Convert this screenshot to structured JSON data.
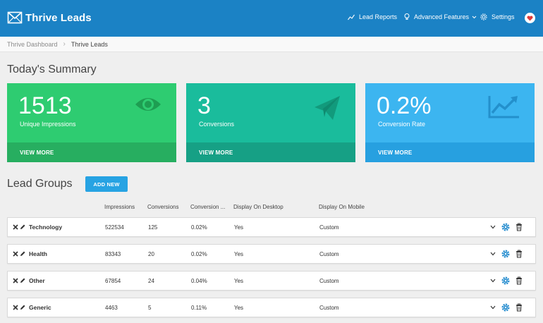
{
  "app": {
    "name": "Thrive Leads"
  },
  "nav": {
    "lead_reports": "Lead Reports",
    "advanced_features": "Advanced Features",
    "settings": "Settings"
  },
  "breadcrumb": {
    "root": "Thrive Dashboard",
    "current": "Thrive Leads"
  },
  "summary": {
    "title": "Today's Summary",
    "cards": [
      {
        "value": "1513",
        "label": "Unique Impressions",
        "action": "VIEW MORE",
        "icon": "eye-icon",
        "color": "#2ecc71"
      },
      {
        "value": "3",
        "label": "Conversions",
        "action": "VIEW MORE",
        "icon": "paper-plane-icon",
        "color": "#1abc9c"
      },
      {
        "value": "0.2%",
        "label": "Conversion Rate",
        "action": "VIEW MORE",
        "icon": "chart-trend-icon",
        "color": "#3cb5f0"
      }
    ]
  },
  "lead_groups": {
    "title": "Lead Groups",
    "add_new": "ADD NEW",
    "columns": [
      "Impressions",
      "Conversions",
      "Conversion ...",
      "Display On Desktop",
      "Display On Mobile"
    ],
    "rows": [
      {
        "name": "Technology",
        "impressions": "522534",
        "conversions": "125",
        "rate": "0.02%",
        "desktop": "Yes",
        "mobile": "Custom"
      },
      {
        "name": "Health",
        "impressions": "83343",
        "conversions": "20",
        "rate": "0.02%",
        "desktop": "Yes",
        "mobile": "Custom"
      },
      {
        "name": "Other",
        "impressions": "67854",
        "conversions": "24",
        "rate": "0.04%",
        "desktop": "Yes",
        "mobile": "Custom"
      },
      {
        "name": "Generic",
        "impressions": "4463",
        "conversions": "5",
        "rate": "0.11%",
        "desktop": "Yes",
        "mobile": "Custom"
      }
    ]
  },
  "colors": {
    "topbar": "#1b82c5",
    "accent_button": "#27a3e3",
    "gear": "#2a8fd0"
  }
}
